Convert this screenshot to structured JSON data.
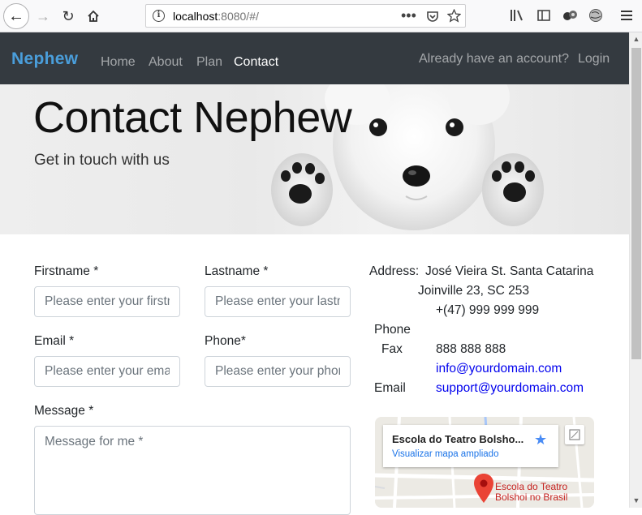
{
  "browser": {
    "url_host": "localhost",
    "url_rest": ":8080/#/",
    "url_more_icon": "three-dots-icon",
    "icons": [
      "back-icon",
      "forward-icon",
      "reload-icon",
      "home-icon",
      "pocket-icon",
      "bookmark-star-icon",
      "library-icon",
      "sidebar-icon",
      "extensions-icon",
      "menu-icon"
    ]
  },
  "navbar": {
    "brand": "Nephew",
    "links": [
      "Home",
      "About",
      "Plan",
      "Contact"
    ],
    "active": "Contact",
    "account_prompt": "Already have an account?",
    "login": "Login",
    "brand_color": "#4a9edb",
    "bg_color": "#343a40"
  },
  "hero": {
    "title": "Contact Nephew",
    "subtitle": "Get in touch with us"
  },
  "form": {
    "firstname_label": "Firstname *",
    "firstname_placeholder": "Please enter your firstname",
    "lastname_label": "Lastname *",
    "lastname_placeholder": "Please enter your lastname",
    "email_label": "Email *",
    "email_placeholder": "Please enter your email",
    "phone_label": "Phone*",
    "phone_placeholder": "Please enter your phone",
    "message_label": "Message *",
    "message_placeholder": "Message for me *"
  },
  "contact": {
    "address_label": "Address:",
    "address_line1": "José Vieira St. Santa Catarina",
    "address_line2": "Joinville 23, SC 253",
    "phone_number": "+(47) 999 999 999",
    "phone_label": "Phone",
    "fax_label": "Fax",
    "fax_number": "888 888 888",
    "info_email": "info@yourdomain.com",
    "email_label": "Email",
    "support_email": "support@yourdomain.com"
  },
  "map": {
    "place_title": "Escola do Teatro Bolsho...",
    "view_larger": "Visualizar mapa ampliado",
    "marker_label_line1": "Escola do Teatro",
    "marker_label_line2": "Bolshoi no Brasil"
  }
}
